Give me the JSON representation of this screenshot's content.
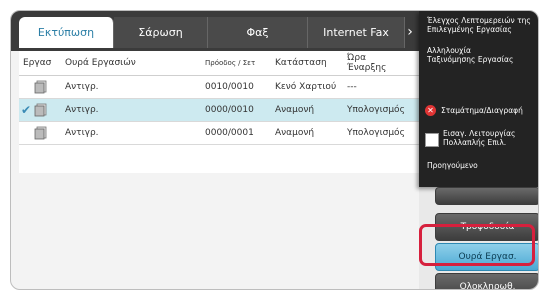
{
  "tabs": [
    {
      "label": "Εκτύπωση",
      "active": true
    },
    {
      "label": "Σάρωση",
      "active": false
    },
    {
      "label": "Φαξ",
      "active": false
    },
    {
      "label": "Internet Fax",
      "active": false
    }
  ],
  "tab_arrow": "›",
  "table": {
    "headers": {
      "job": "Εργασ",
      "queue": "Ουρά Εργασιών",
      "progress": "Πρόοδος / Σετ",
      "status": "Κατάσταση",
      "start_line1": "Ώρα",
      "start_line2": "Έναρξης"
    },
    "rows": [
      {
        "queue": "Αντιγρ.",
        "progress": "0010/0010",
        "status": "Κενό Χαρτιού",
        "start": "---",
        "selected": false
      },
      {
        "queue": "Αντιγρ.",
        "progress": "0000/0010",
        "status": "Αναμονή",
        "start": "Υπολογισμός",
        "selected": true
      },
      {
        "queue": "Αντιγρ.",
        "progress": "0000/0001",
        "status": "Αναμονή",
        "start": "Υπολογισμός",
        "selected": false
      }
    ]
  },
  "menu": {
    "item1_line1": "Έλεγχος Λεπτομερειών της",
    "item1_line2": "Επιλεγμένης Εργασίας",
    "item2_line1": "Αλληλουχία",
    "item2_line2": "Ταξινόμησης Εργασίας",
    "item3": "Σταμάτημα/Διαγραφή",
    "item4_line1": "Εισαγ. Λειτουργίας",
    "item4_line2": "Πολλαπλής Επιλ.",
    "item5": "Προηγούμενο"
  },
  "buttons": {
    "b1": "Τροφοδοσία",
    "b2": "Ουρά Εργασ.",
    "b3": "Ολοκληρωθ."
  },
  "colors": {
    "highlight": "#d6203d",
    "selected_row": "#cdeaf0",
    "active_tab_text": "#2c7fa6"
  }
}
